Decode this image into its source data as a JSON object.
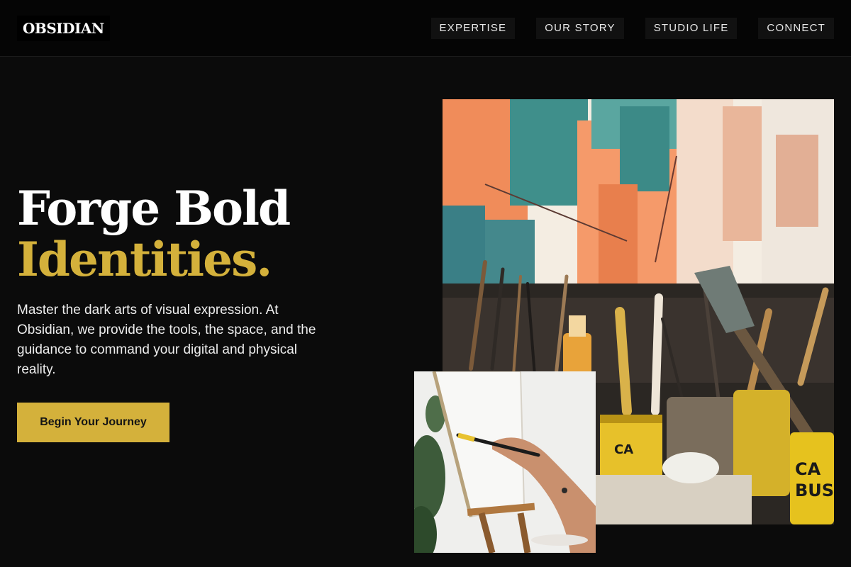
{
  "brand": {
    "logo_text": "OBSIDIAN"
  },
  "nav": {
    "items": [
      {
        "label": "EXPERTISE"
      },
      {
        "label": "OUR STORY"
      },
      {
        "label": "STUDIO LIFE"
      },
      {
        "label": "CONNECT"
      }
    ]
  },
  "hero": {
    "title_line1": "Forge Bold",
    "title_line2": "Identities.",
    "description": "Master the dark arts of visual expression. At Obsidian, we provide the tools, the space, and the guidance to command your digital and physical reality.",
    "cta_label": "Begin Your Journey"
  },
  "colors": {
    "background": "#0b0b0b",
    "header_background": "#050505",
    "accent_gold": "#d4b13b",
    "text_primary": "#ffffff"
  }
}
